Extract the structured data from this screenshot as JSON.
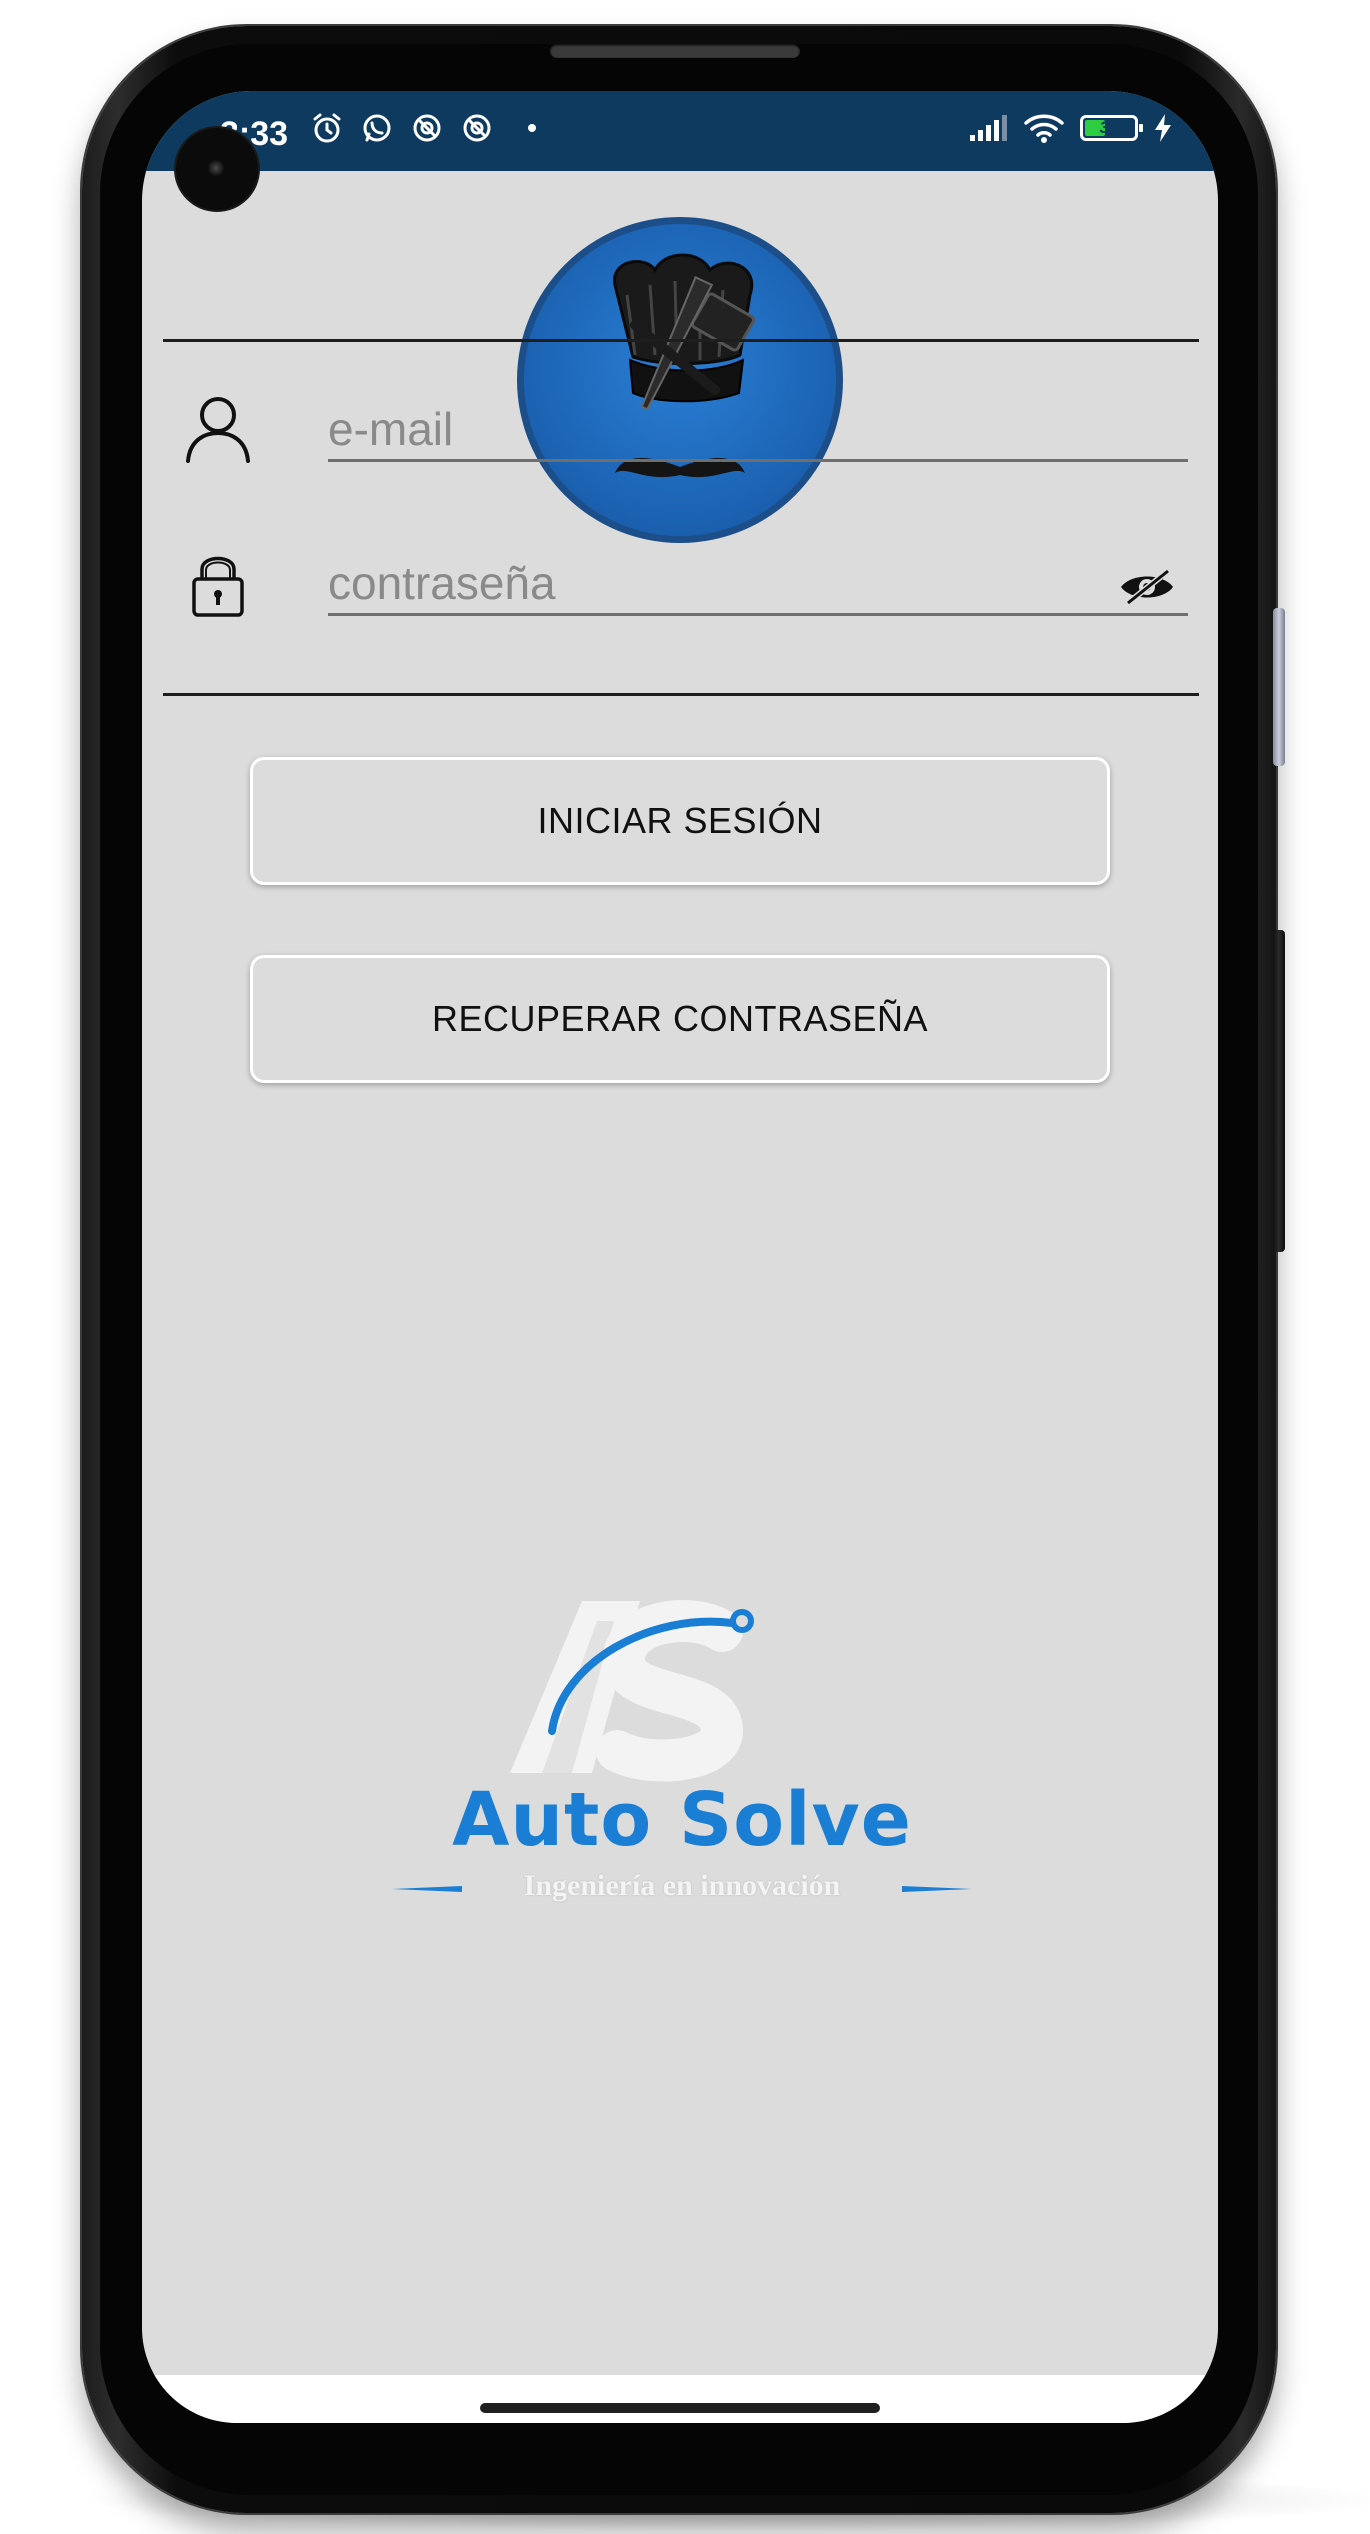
{
  "status_bar": {
    "time": "3:33",
    "battery": "39",
    "left_icons": [
      "alarm-icon",
      "whatsapp-icon",
      "no-disturb-icon",
      "no-disturb-icon"
    ],
    "right_icons": [
      "signal-icon",
      "wifi-icon",
      "battery-icon",
      "charging-icon"
    ]
  },
  "login": {
    "email_placeholder": "e-mail",
    "password_placeholder": "contraseña",
    "login_button": "INICIAR SESIÓN",
    "recover_button": "RECUPERAR CONTRASEÑA"
  },
  "brand": {
    "name": "Auto Solve",
    "tagline": "Ingeniería en innovación",
    "monogram": "AS"
  },
  "colors": {
    "status_bar": "#0e3a5f",
    "screen_bg": "#dcdcdc",
    "logo_blue": "#1f6bbf",
    "brand_blue": "#1a7fd4"
  }
}
